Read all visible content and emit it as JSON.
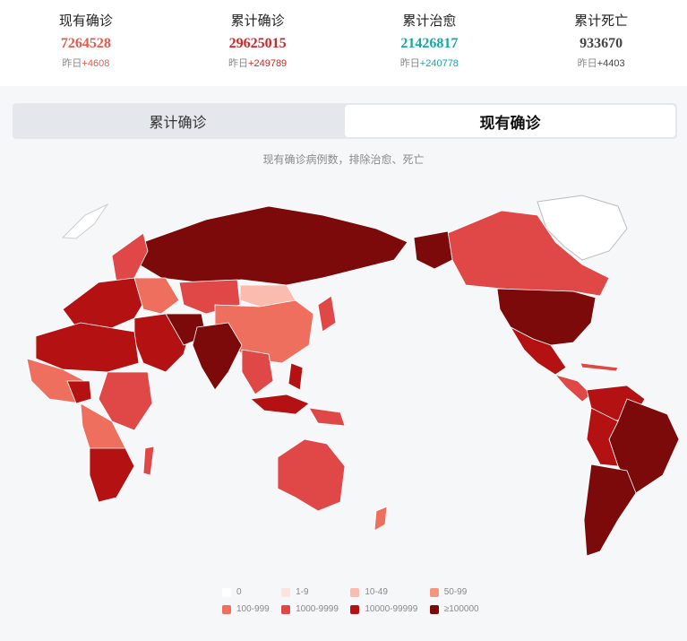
{
  "stats": [
    {
      "label": "现有确诊",
      "value": "7264528",
      "delta_prefix": "昨日",
      "delta": "+4608",
      "color": "#e25a4e"
    },
    {
      "label": "累计确诊",
      "value": "29625015",
      "delta_prefix": "昨日",
      "delta": "+249789",
      "color": "#c8282a"
    },
    {
      "label": "累计治愈",
      "value": "21426817",
      "delta_prefix": "昨日",
      "delta": "+240778",
      "color": "#1aa6a6"
    },
    {
      "label": "累计死亡",
      "value": "933670",
      "delta_prefix": "昨日",
      "delta": "+4403",
      "color": "#444444"
    }
  ],
  "tabs": [
    {
      "label": "累计确诊",
      "active": false
    },
    {
      "label": "现有确诊",
      "active": true
    }
  ],
  "caption": "现有确诊病例数，排除治愈、死亡",
  "legend": [
    {
      "label": "0",
      "color": "#ffffff"
    },
    {
      "label": "1-9",
      "color": "#fde3dd"
    },
    {
      "label": "10-49",
      "color": "#fbbcaf"
    },
    {
      "label": "50-99",
      "color": "#f6957f"
    },
    {
      "label": "100-999",
      "color": "#ef6f5f"
    },
    {
      "label": "1000-9999",
      "color": "#e04848"
    },
    {
      "label": "10000-99999",
      "color": "#b41212"
    },
    {
      "label": "≥100000",
      "color": "#7c0a0a"
    }
  ]
}
